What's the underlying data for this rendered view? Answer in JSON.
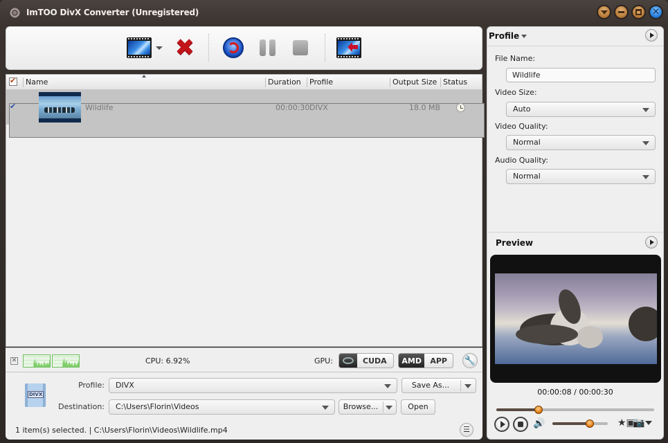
{
  "window": {
    "title": "ImTOO DivX Converter (Unregistered)",
    "controls": [
      "menu",
      "minimize",
      "maximize",
      "close"
    ],
    "close_color": "#1f77d6",
    "accent_bronze": "#b57733"
  },
  "toolbar": {
    "add_label": "Add Video",
    "remove_label": "Remove",
    "convert_label": "Convert",
    "pause_label": "Pause",
    "stop_label": "Stop",
    "export_label": "Export to Device"
  },
  "file_list": {
    "columns": [
      "Name",
      "Duration",
      "Profile",
      "Output Size",
      "Status"
    ],
    "sorted_by": "Name",
    "select_all_checked": true,
    "rows": [
      {
        "checked": true,
        "name": "Wildlife",
        "duration": "00:00:30",
        "profile": "DIVX",
        "output_size": "18.0 MB",
        "status_icon": "clock-icon"
      }
    ]
  },
  "cpu": {
    "label": "CPU: 6.92%",
    "value_percent": 6.92,
    "graph_color": "#6fbf5f"
  },
  "gpu": {
    "label": "GPU:",
    "cuda_label": "CUDA",
    "amd_label": "AMD",
    "app_label": "APP"
  },
  "bottom": {
    "profile_label": "Profile:",
    "profile_value": "DIVX",
    "save_as_label": "Save As...",
    "destination_label": "Destination:",
    "destination_value": "C:\\Users\\Florin\\Videos",
    "browse_label": "Browse...",
    "open_label": "Open",
    "status_text": "1 item(s) selected. | C:\\Users\\Florin\\Videos\\Wildlife.mp4",
    "divx_badge": "DIVX"
  },
  "profile_panel": {
    "title": "Profile",
    "file_name_label": "File Name:",
    "file_name_value": "Wildlife",
    "video_size_label": "Video Size:",
    "video_size_value": "Auto",
    "video_quality_label": "Video Quality:",
    "video_quality_value": "Normal",
    "audio_quality_label": "Audio Quality:",
    "audio_quality_value": "Normal"
  },
  "preview": {
    "title": "Preview",
    "time_text": "00:00:08 / 00:00:30",
    "current_seconds": 8,
    "total_seconds": 30,
    "volume_fraction": 0.68,
    "knob_color": "#e07a12"
  }
}
